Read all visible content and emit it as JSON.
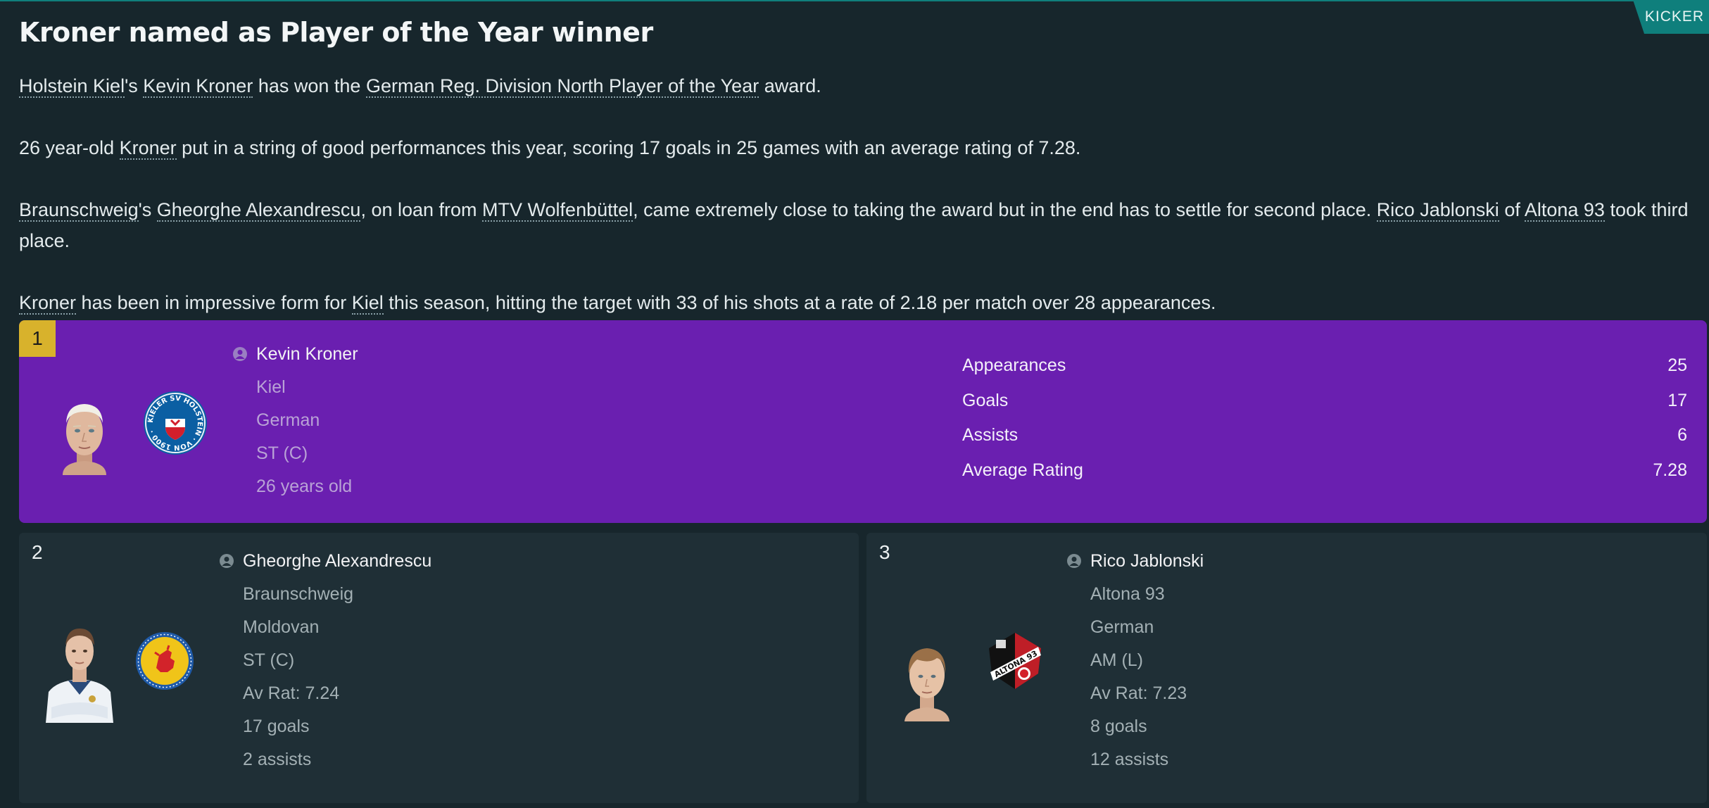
{
  "source": "KICKER",
  "headline": "Kroner named as Player of the Year winner",
  "article": {
    "p1": {
      "club_link": "Holstein Kiel",
      "s1": "'s ",
      "player_link": "Kevin Kroner",
      "s2": " has won the ",
      "comp_link": "German Reg. Division North Player of the Year",
      "s3": " award."
    },
    "p2": {
      "s1": "26 year-old ",
      "player_link": "Kroner",
      "s2": " put in a string of good performances this year, scoring 17 goals in 25 games with an average rating of 7.28."
    },
    "p3": {
      "club_link": "Braunschweig",
      "s1": "'s ",
      "player_link": "Gheorghe Alexandrescu",
      "s2": ", on loan from ",
      "loan_link": "MTV Wolfenbüttel",
      "s3": ", came extremely close to taking the award but in the end has to settle for second place. ",
      "third_link": "Rico Jablonski",
      "s4": " of ",
      "third_club_link": "Altona 93",
      "s5": " took third place."
    },
    "p4": {
      "player_link": "Kroner",
      "s1": " has been in impressive form for ",
      "club_link": "Kiel",
      "s2": " this season, hitting the target with 33 of his shots at a rate of 2.18 per match over 28 appearances."
    }
  },
  "winner": {
    "rank": "1",
    "name": "Kevin Kroner",
    "club": "Kiel",
    "nationality": "German",
    "position": "ST (C)",
    "age": "26 years old",
    "crest_text": "KIELER SV HOLSTEIN · VON 1900 ·",
    "stats": [
      {
        "label": "Appearances",
        "value": "25"
      },
      {
        "label": "Goals",
        "value": "17"
      },
      {
        "label": "Assists",
        "value": "6"
      },
      {
        "label": "Average Rating",
        "value": "7.28"
      }
    ]
  },
  "runners_up": [
    {
      "rank": "2",
      "name": "Gheorghe Alexandrescu",
      "club": "Braunschweig",
      "nationality": "Moldovan",
      "position": "ST (C)",
      "rating": "Av Rat: 7.24",
      "goals": "17 goals",
      "assists": "2 assists"
    },
    {
      "rank": "3",
      "name": "Rico Jablonski",
      "club": "Altona 93",
      "nationality": "German",
      "position": "AM (L)",
      "rating": "Av Rat: 7.23",
      "goals": "8 goals",
      "assists": "12 assists",
      "crest_text": "ALTONA 93"
    }
  ],
  "colors": {
    "background": "#17262c",
    "accent_teal": "#0f7f7c",
    "winner_card": "#6a1fb0",
    "rank_gold": "#d8b22c",
    "runner_card": "#1f2f36"
  },
  "icons": [
    "person-icon"
  ]
}
